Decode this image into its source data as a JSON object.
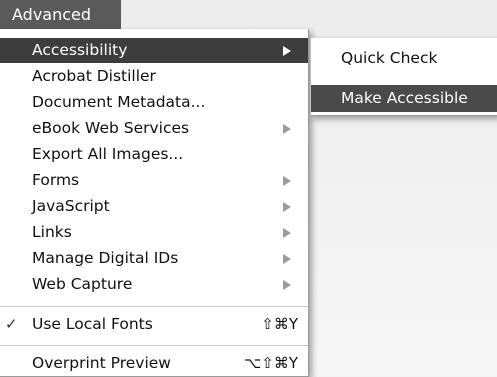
{
  "menubar": {
    "title": "Advanced"
  },
  "menu": {
    "items": [
      {
        "label": "Accessibility",
        "submenu": true,
        "selected": true
      },
      {
        "label": "Acrobat Distiller"
      },
      {
        "label": "Document Metadata..."
      },
      {
        "label": "eBook Web Services",
        "submenu": true
      },
      {
        "label": "Export All Images..."
      },
      {
        "label": "Forms",
        "submenu": true
      },
      {
        "label": "JavaScript",
        "submenu": true
      },
      {
        "label": "Links",
        "submenu": true
      },
      {
        "label": "Manage Digital IDs",
        "submenu": true
      },
      {
        "label": "Web Capture",
        "submenu": true
      },
      {
        "label": "Use Local Fonts",
        "checked": true,
        "shortcut": "⇧⌘Y"
      },
      {
        "label": "Overprint Preview",
        "shortcut": "⌥⇧⌘Y"
      }
    ],
    "check_mark": "✓"
  },
  "submenu": {
    "items": [
      {
        "label": "Quick Check"
      },
      {
        "label": "Make Accessible",
        "selected": true
      }
    ]
  },
  "colors": {
    "menubar_bg": "#5a5a5a",
    "selected_bg": "#3d3d3d",
    "arrow": "#9b9b9b"
  }
}
